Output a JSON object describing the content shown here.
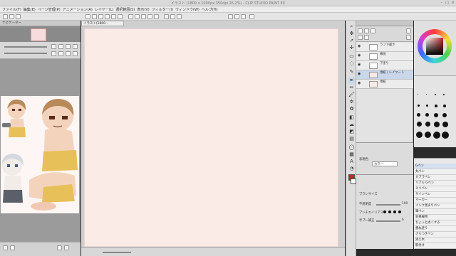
{
  "window": {
    "title": "イラスト (1800 x 1000px 350dpi 26.2%) - CLIP STUDIO PAINT EX",
    "controls": [
      "–",
      "□",
      "×"
    ]
  },
  "menu": [
    "ファイル(F)",
    "編集(E)",
    "ページ管理(P)",
    "アニメーション(A)",
    "レイヤー(L)",
    "選択範囲(S)",
    "表示(V)",
    "フィルター(I)",
    "ウィンドウ(W)",
    "ヘルプ(H)"
  ],
  "navigator": {
    "title": "ナビゲーター"
  },
  "canvas_tab": {
    "label": "イラスト(1800..."
  },
  "layers": {
    "rows": [
      {
        "name": "ラフ下書き"
      },
      {
        "name": "線画"
      },
      {
        "name": "下塗り"
      },
      {
        "name": "用紙 / レイヤー 1"
      },
      {
        "name": "用紙"
      }
    ]
  },
  "properties": {
    "expression": "表現色",
    "color_mode": "カラー",
    "brush_size": "ブラシサイズ",
    "opacity": "不透明度",
    "anti_alias": "アンチエイリアス",
    "stabilization": "手ブレ補正",
    "opacity_val": "100",
    "stab_val": "6"
  },
  "colors": {
    "main": "#c0282a",
    "sub": "#ffffff"
  },
  "sub_tools": [
    "Gペン",
    "丸ペン",
    "カブラペン",
    "リアル Gペン",
    "ミリペン",
    "サインペン",
    "マーカー",
    "インク溜まりペン",
    "筆ペン",
    "効果線用",
    "ちょっと太くする",
    "重ね塗り",
    "ざらつきペン",
    "添え木",
    "影付け"
  ]
}
